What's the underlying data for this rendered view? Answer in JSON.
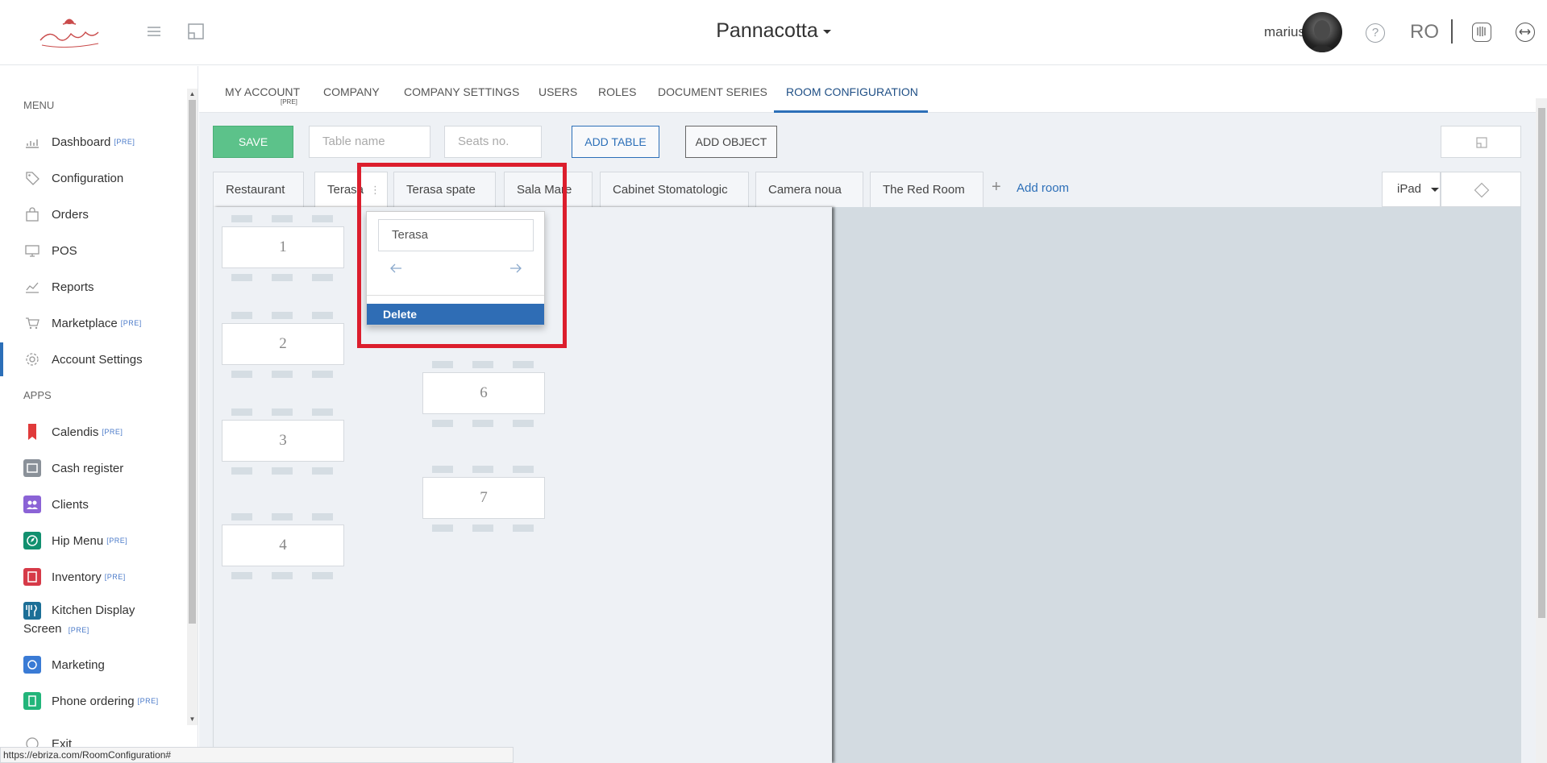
{
  "header": {
    "restaurant_name": "Pannacotta",
    "username": "marius",
    "language": "RO"
  },
  "sidebar": {
    "menu_heading": "MENU",
    "apps_heading": "APPS",
    "menu_items": [
      {
        "label": "Dashboard",
        "badge": "[PRE]",
        "icon": "chart-icon"
      },
      {
        "label": "Configuration",
        "badge": "",
        "icon": "tag-icon"
      },
      {
        "label": "Orders",
        "badge": "",
        "icon": "bag-icon"
      },
      {
        "label": "POS",
        "badge": "",
        "icon": "monitor-icon"
      },
      {
        "label": "Reports",
        "badge": "",
        "icon": "report-icon"
      },
      {
        "label": "Marketplace",
        "badge": "[PRE]",
        "icon": "cart-icon"
      },
      {
        "label": "Account Settings",
        "badge": "",
        "icon": "gear-icon"
      }
    ],
    "app_items": [
      {
        "label": "Calendis",
        "badge": "[PRE]",
        "color": "#e03a3a"
      },
      {
        "label": "Cash register",
        "badge": "",
        "color": "#8a9199"
      },
      {
        "label": "Clients",
        "badge": "",
        "color": "#8b63d6"
      },
      {
        "label": "Hip Menu",
        "badge": "[PRE]",
        "color": "#12906f"
      },
      {
        "label": "Inventory",
        "badge": "[PRE]",
        "color": "#d63a48"
      },
      {
        "label": "Kitchen Display",
        "label2": "Screen",
        "badge": "[PRE]",
        "color": "#1c6f97"
      },
      {
        "label": "Marketing",
        "badge": "",
        "color": "#3a7bd5"
      },
      {
        "label": "Phone ordering",
        "badge": "[PRE]",
        "color": "#22b57a"
      },
      {
        "label": "Exit",
        "badge": "",
        "color": "#999"
      }
    ]
  },
  "settings_tabs": [
    {
      "label": "MY ACCOUNT",
      "sub": "[PRE]"
    },
    {
      "label": "COMPANY"
    },
    {
      "label": "COMPANY SETTINGS"
    },
    {
      "label": "USERS"
    },
    {
      "label": "ROLES"
    },
    {
      "label": "DOCUMENT SERIES"
    },
    {
      "label": "ROOM CONFIGURATION",
      "active": true
    }
  ],
  "toolbar": {
    "save_label": "SAVE",
    "table_name_placeholder": "Table name",
    "seats_placeholder": "Seats no.",
    "add_table_label": "ADD TABLE",
    "add_object_label": "ADD OBJECT"
  },
  "rooms": [
    {
      "label": "Restaurant"
    },
    {
      "label": "Terasa",
      "active": true
    },
    {
      "label": "Terasa spate"
    },
    {
      "label": "Sala Mare"
    },
    {
      "label": "Cabinet Stomatologic"
    },
    {
      "label": "Camera noua"
    },
    {
      "label": "The Red Room"
    }
  ],
  "add_room_label": "Add room",
  "device": "iPad",
  "tables": [
    "1",
    "2",
    "3",
    "4",
    "6",
    "7"
  ],
  "popup": {
    "name_value": "Terasa",
    "delete_label": "Delete"
  },
  "status_url": "https://ebriza.com/RoomConfiguration#",
  "colors": {
    "accent": "#2c6fb8",
    "save": "#5cc28a",
    "highlight": "#dc1e2d"
  }
}
